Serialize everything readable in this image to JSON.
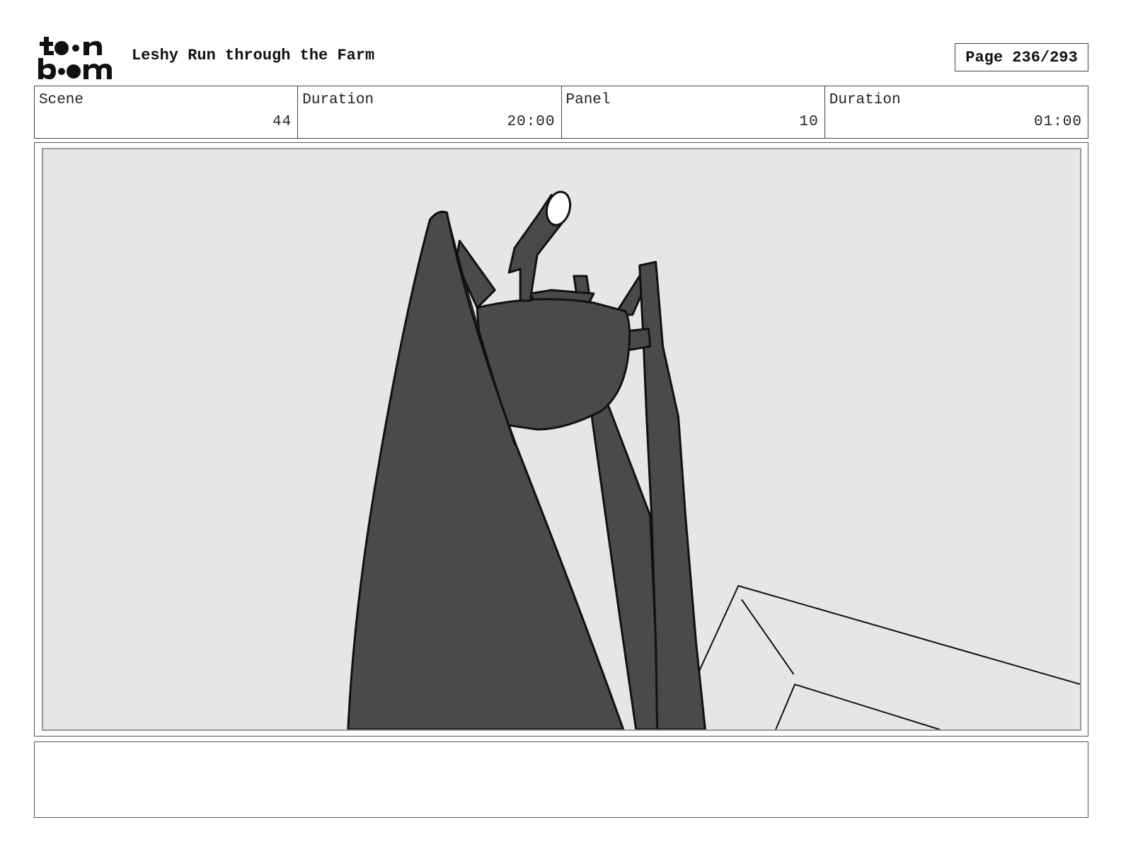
{
  "header": {
    "logo_alt": "toon boom",
    "title": "Leshy Run through the Farm",
    "page_label": "Page 236/293"
  },
  "info_bar": {
    "scene_label": "Scene",
    "scene_value": "44",
    "scene_duration_label": "Duration",
    "scene_duration_value": "20:00",
    "panel_label": "Panel",
    "panel_value": "10",
    "panel_duration_label": "Duration",
    "panel_duration_value": "01:00"
  },
  "panel": {
    "background_color": "#e6e6e6",
    "figure_fill": "#4a4a4a",
    "outline_color": "#111111"
  },
  "notes": {
    "text": ""
  }
}
